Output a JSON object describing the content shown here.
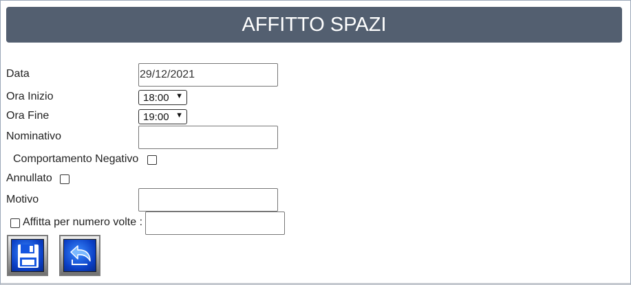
{
  "header": {
    "title": "AFFITTO SPAZI"
  },
  "form": {
    "data": {
      "label": "Data",
      "value": "29/12/2021"
    },
    "ora_inizio": {
      "label": "Ora Inizio",
      "value": "18:00"
    },
    "ora_fine": {
      "label": "Ora Fine",
      "value": "19:00"
    },
    "nominativo": {
      "label": "Nominativo",
      "value": ""
    },
    "comportamento_negativo": {
      "label": "Comportamento Negativo",
      "checked": false
    },
    "annullato": {
      "label": "Annullato",
      "checked": false
    },
    "motivo": {
      "label": "Motivo",
      "value": ""
    },
    "affitta_per_numero": {
      "label": "Affitta per numero volte :",
      "checked": false,
      "value": ""
    }
  },
  "buttons": {
    "save_icon": "floppy-disk-icon",
    "back_icon": "undo-arrow-icon"
  },
  "colors": {
    "header_bg": "#535f70",
    "button_blue": "#1556e0"
  }
}
